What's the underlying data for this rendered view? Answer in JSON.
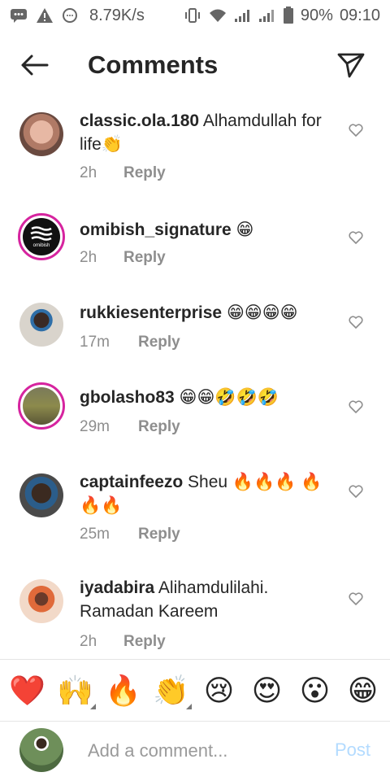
{
  "status_bar": {
    "speed": "8.79K/s",
    "battery": "90%",
    "time": "09:10"
  },
  "header": {
    "title": "Comments"
  },
  "comments": [
    {
      "username": "classic.ola.180",
      "text": "Alhamdullah for life👏",
      "time": "2h",
      "reply": "Reply"
    },
    {
      "username": "omibish_signature",
      "text": "😁",
      "time": "2h",
      "reply": "Reply",
      "avatar_logo_text": "omibish"
    },
    {
      "username": "rukkiesenterprise",
      "text": "😁😁😁😁",
      "time": "17m",
      "reply": "Reply"
    },
    {
      "username": "gbolasho83",
      "text": "😁😁🤣🤣🤣",
      "time": "29m",
      "reply": "Reply"
    },
    {
      "username": "captainfeezo",
      "text": "Sheu 🔥🔥🔥 🔥🔥🔥",
      "time": "25m",
      "reply": "Reply"
    },
    {
      "username": "iyadabira",
      "text": "Alihamdulilahi. Ramadan Kareem",
      "time": "2h",
      "reply": "Reply"
    }
  ],
  "emoji_bar": [
    "❤️",
    "🙌",
    "🔥",
    "👏",
    "😢",
    "😍",
    "😮",
    "😁"
  ],
  "composer": {
    "placeholder": "Add a comment...",
    "post_label": "Post"
  },
  "colors": {
    "story_ring": "#d6249f",
    "post_disabled": "#b3dbff",
    "meta_gray": "#8e8e8e"
  }
}
